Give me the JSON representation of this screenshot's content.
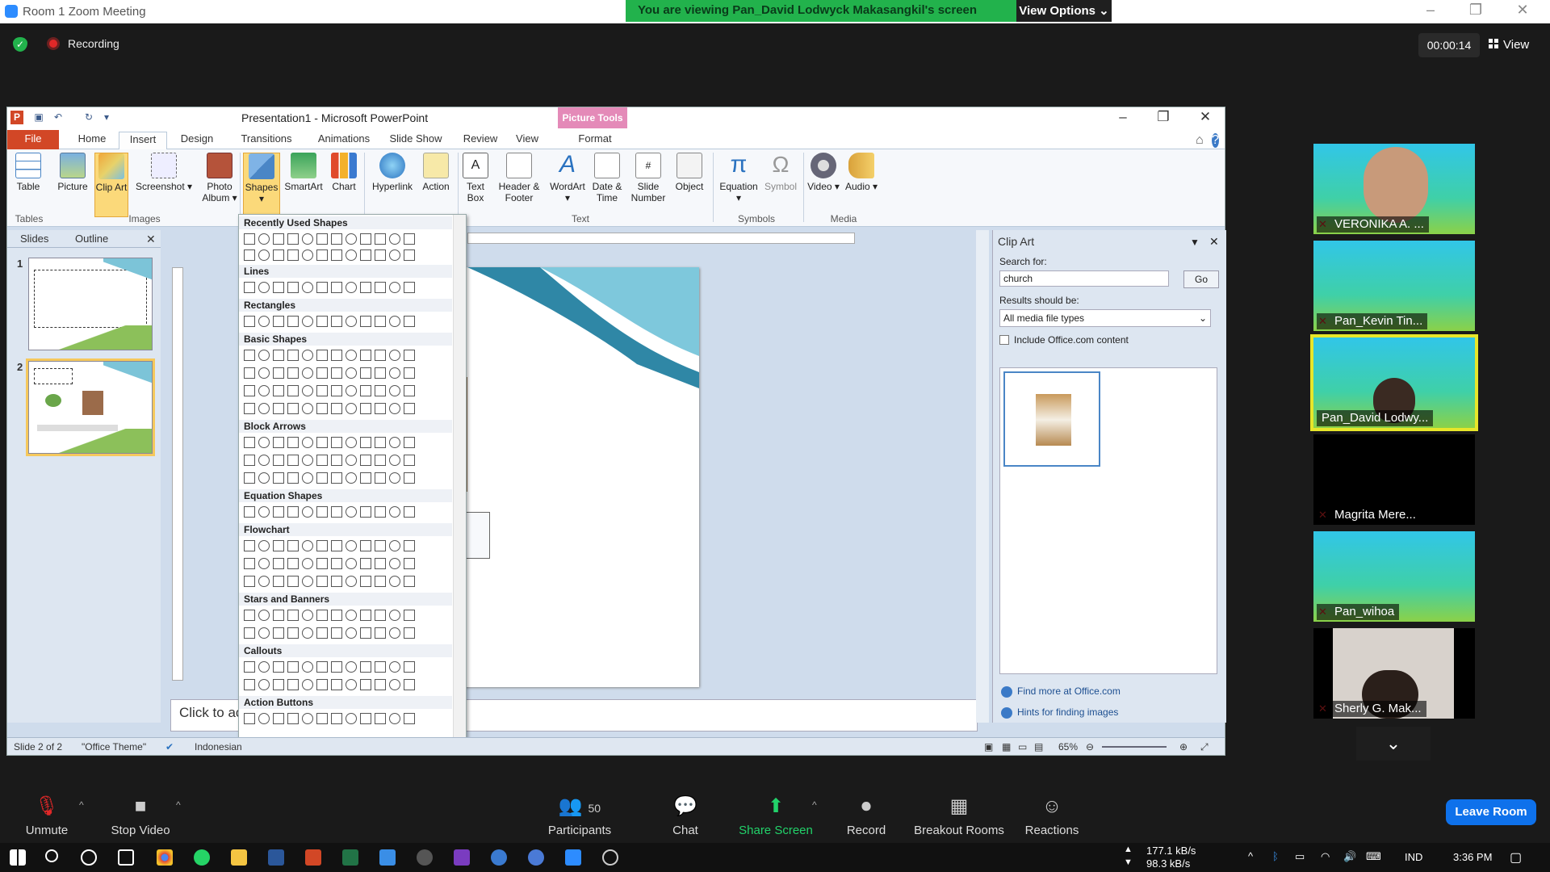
{
  "zoom": {
    "window_title": "Room 1   Zoom Meeting",
    "share_banner": "You are viewing Pan_David Lodwyck Makasangkil's screen",
    "view_options": "View Options",
    "recording": "Recording",
    "timer": "00:00:14",
    "view": "View",
    "toolbar": {
      "unmute": "Unmute",
      "stop_video": "Stop Video",
      "participants": "Participants",
      "participants_count": "50",
      "chat": "Chat",
      "share_screen": "Share Screen",
      "record": "Record",
      "breakout_rooms": "Breakout Rooms",
      "reactions": "Reactions",
      "leave_room": "Leave Room"
    },
    "participants_tiles": [
      {
        "name": "VERONIKA A. ..."
      },
      {
        "name": "Pan_Kevin Tin..."
      },
      {
        "name": "Pan_David Lodwy..."
      },
      {
        "name": "Magrita Mere..."
      },
      {
        "name": "Pan_wihoa"
      },
      {
        "name": "Sherly G. Mak..."
      }
    ]
  },
  "ppt": {
    "title": "Presentation1 - Microsoft PowerPoint",
    "picture_tools": "Picture Tools",
    "tabs": [
      "File",
      "Home",
      "Insert",
      "Design",
      "Transitions",
      "Animations",
      "Slide Show",
      "Review",
      "View",
      "Format"
    ],
    "ribbon": {
      "table": "Table",
      "picture": "Picture",
      "clip_art": "Clip Art",
      "screenshot": "Screenshot",
      "photo_album": "Photo Album",
      "shapes": "Shapes",
      "smartart": "SmartArt",
      "chart": "Chart",
      "hyperlink": "Hyperlink",
      "action": "Action",
      "text_box": "Text Box",
      "header_footer": "Header & Footer",
      "wordart": "WordArt",
      "date_time": "Date & Time",
      "slide_number": "Slide Number",
      "object": "Object",
      "equation": "Equation",
      "symbol": "Symbol",
      "video": "Video",
      "audio": "Audio",
      "groups": {
        "tables": "Tables",
        "images": "Images",
        "text": "Text",
        "symbols": "Symbols",
        "media": "Media"
      }
    },
    "pane_tabs": {
      "slides": "Slides",
      "outline": "Outline"
    },
    "slide_numbers": [
      "1",
      "2"
    ],
    "notes_placeholder": "Click to ac",
    "gallery": {
      "recently_used": "Recently Used Shapes",
      "lines": "Lines",
      "rectangles": "Rectangles",
      "basic_shapes": "Basic Shapes",
      "block_arrows": "Block Arrows",
      "equation_shapes": "Equation Shapes",
      "flowchart": "Flowchart",
      "stars_banners": "Stars and Banners",
      "callouts": "Callouts",
      "action_buttons": "Action Buttons"
    },
    "clipart": {
      "title": "Clip Art",
      "search_label": "Search for:",
      "search_value": "church",
      "go": "Go",
      "results_label": "Results should be:",
      "results_value": "All media file types",
      "include_label": "Include Office.com content",
      "find_more": "Find more at Office.com",
      "hints": "Hints for finding images"
    },
    "status": {
      "slide": "Slide 2 of 2",
      "theme": "\"Office Theme\"",
      "language": "Indonesian",
      "zoom": "65%"
    }
  },
  "taskbar": {
    "net_up": "177.1 kB/s",
    "net_down": "98.3 kB/s",
    "lang": "IND",
    "time": "3:36 PM"
  }
}
